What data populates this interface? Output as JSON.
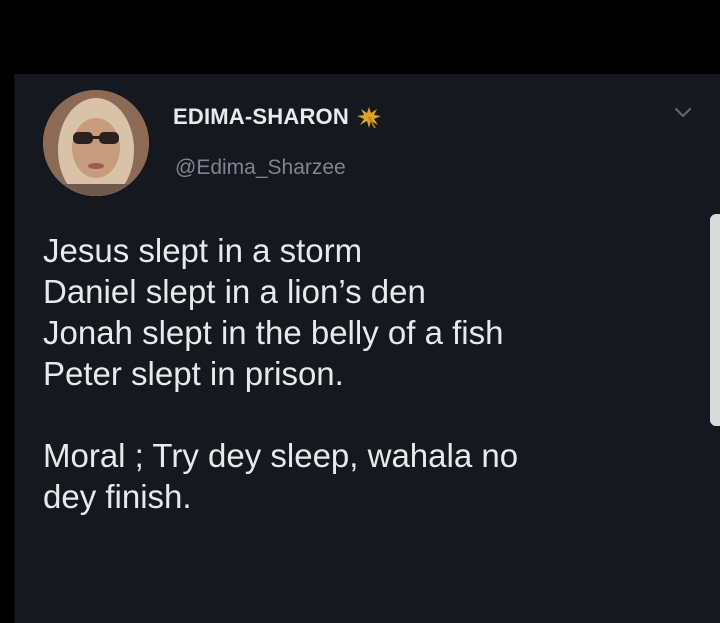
{
  "tweet": {
    "display_name": "EDIMA-SHARON",
    "handle": "@Edima_Sharzee",
    "verified_icon": "leaf-emoji-icon",
    "menu_icon": "chevron-down-icon",
    "text_lines": [
      "Jesus slept in a storm",
      "Daniel slept in a lion’s den",
      "Jonah slept in the belly of a fish",
      "Peter slept in prison."
    ],
    "moral_lines": [
      "Moral ; Try dey sleep, wahala no",
      "dey finish."
    ]
  },
  "colors": {
    "background": "#000000",
    "card": "#15181f",
    "text": "#e8e9eb",
    "handle": "#7d8590",
    "leaf": "#e0a12a"
  }
}
